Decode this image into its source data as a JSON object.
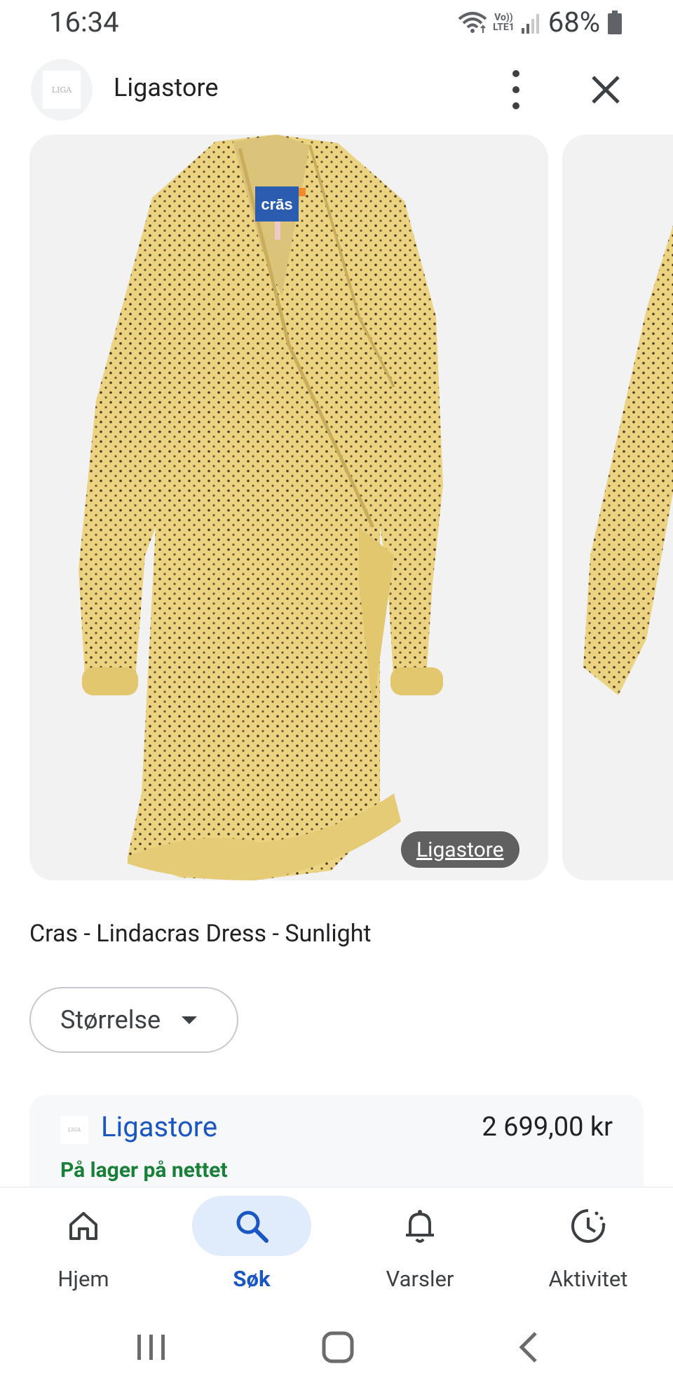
{
  "status_bar": {
    "time": "16:34",
    "network_top": "Vo))",
    "network_bottom": "LTE1",
    "battery": "68%",
    "icons": [
      "wifi-icon",
      "signal-icon",
      "battery-icon"
    ]
  },
  "header": {
    "site_logo_text": "LIGA",
    "site_name": "Ligastore",
    "more_icon": "more-vert-icon",
    "close_icon": "close-icon"
  },
  "carousel": {
    "brand_tag": "crās",
    "source_chip": "Ligastore"
  },
  "product": {
    "title": "Cras - Lindacras Dress - Sunlight"
  },
  "size_select": {
    "label": "Størrelse"
  },
  "offer": {
    "store_logo_text": "LIGA",
    "store_name": "Ligastore",
    "price": "2 699,00 kr",
    "stock": "På lager på nettet"
  },
  "bottom_nav": {
    "items": [
      {
        "label": "Hjem",
        "icon": "home-icon"
      },
      {
        "label": "Søk",
        "icon": "search-icon",
        "active": true
      },
      {
        "label": "Varsler",
        "icon": "bell-icon"
      },
      {
        "label": "Aktivitet",
        "icon": "activity-icon"
      }
    ]
  },
  "colors": {
    "accent_blue": "#1a56c4",
    "active_pill": "#e0ebfc",
    "stock_green": "#188038",
    "dress_yellow": "#ecd382"
  }
}
